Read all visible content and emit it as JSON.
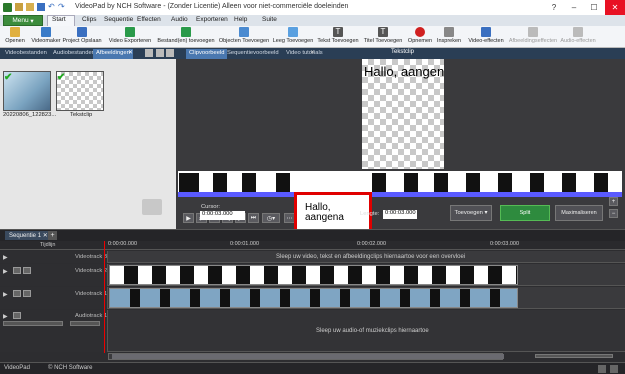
{
  "window": {
    "title": "VideoPad by NCH Software - (Zonder Licentie) Alleen voor niet-commerciële doeleinden"
  },
  "menubar": {
    "menu_button": "Menu",
    "tabs": [
      "Start",
      "Clips",
      "Sequentie",
      "Effecten",
      "Audio",
      "Exporteren",
      "Help",
      "Suite"
    ]
  },
  "toolbar": {
    "items": [
      "Openen",
      "Videomaker",
      "Project Opslaan",
      "Video Exporteren",
      "Bestand(en) toevoegen",
      "Objecten Toevoegen",
      "Leeg Toevoegen",
      "Tekst Toevoegen",
      "Titel Toevoegen",
      "Opnemen",
      "Inspreken",
      "Video-effecten",
      "Afbeeldingseffecten",
      "Audio-effecten"
    ]
  },
  "left_tabs": [
    "Videobestanden",
    "Audiobestanden",
    "Afbeeldingen"
  ],
  "clips": [
    {
      "label": "20220806_122823..."
    },
    {
      "label": "Tekstclip"
    }
  ],
  "preview_tabs": [
    "Clipvoorbeeld",
    "Sequentievoorbeeld",
    "Video tutorials"
  ],
  "preview": {
    "header": "Tekstclip",
    "text": "Hallo, aangen",
    "small_text": "Hallo,\naangena"
  },
  "controls": {
    "cursor_label": "Cursor:",
    "cursor_value": "0:00:03.000",
    "length_label": "Lengte:",
    "length_value": "0:00:03.000",
    "add_button": "Toevoegen",
    "split_button": "Split",
    "max_button": "Maximaliseren"
  },
  "sequence": {
    "tab": "Sequentie 1",
    "ruler_label": "Tijdlijn",
    "ticks": [
      "0:00:00.000",
      "0:00:01.000",
      "0:00:02.000",
      "0:00:03.000"
    ]
  },
  "tracks": {
    "video3": {
      "name": "Videotrack 3",
      "hint": "Sleep uw video, tekst en afbeeldingclips hiernaartoe voor een overvloei"
    },
    "video2": {
      "name": "Videotrack 2"
    },
    "video1": {
      "name": "Videotrack 1"
    },
    "audio1": {
      "name": "Audiotrack 1",
      "hint": "Sleep uw audio-of muziekclips hiernaartoe"
    }
  },
  "status": {
    "left": "VideoPad",
    "right": "© NCH Software"
  }
}
